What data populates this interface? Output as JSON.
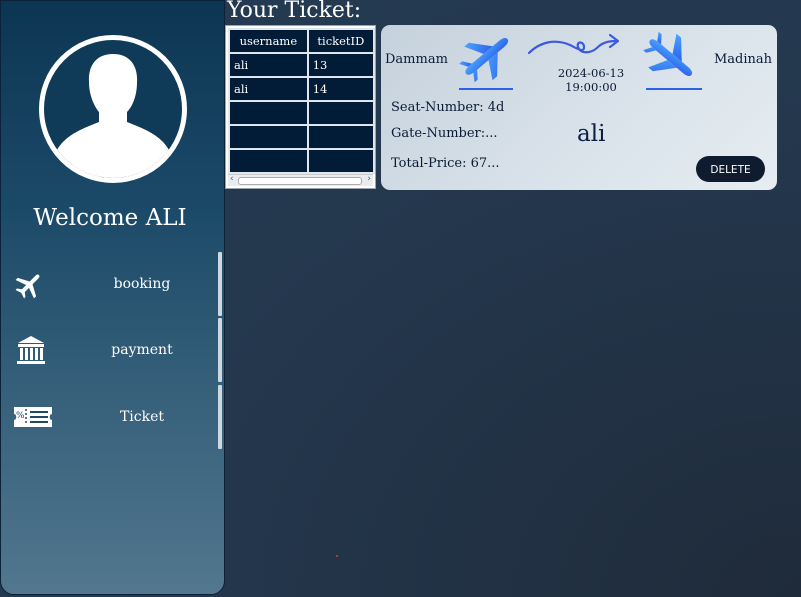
{
  "sidebar": {
    "welcome": "Welcome ALI",
    "items": [
      {
        "label": "booking",
        "icon": "airplane-icon"
      },
      {
        "label": "payment",
        "icon": "bank-icon"
      },
      {
        "label": "Ticket",
        "icon": "ticket-icon"
      }
    ]
  },
  "main": {
    "title": "Your Ticket:",
    "table": {
      "headers": [
        "username",
        "ticketID"
      ],
      "rows": [
        [
          "ali",
          "13"
        ],
        [
          "ali",
          "14"
        ],
        [
          "",
          ""
        ],
        [
          "",
          ""
        ],
        [
          "",
          ""
        ]
      ]
    },
    "ticket": {
      "from": "Dammam",
      "to": "Madinah",
      "date": "2024-06-13",
      "time": "19:00:00",
      "seat": "Seat-Number: 4d",
      "gate": "Gate-Number:...",
      "price": "Total-Price: 67...",
      "passenger": "ali",
      "delete_label": "DELETE"
    }
  },
  "colors": {
    "sidebar_top": "#0c3553",
    "sidebar_bottom": "#52778f",
    "table_cell": "#021b36",
    "card_bg": "#d9e2ea",
    "delete_button": "#0f1b2e",
    "plane_blue": "#2f80f0"
  }
}
